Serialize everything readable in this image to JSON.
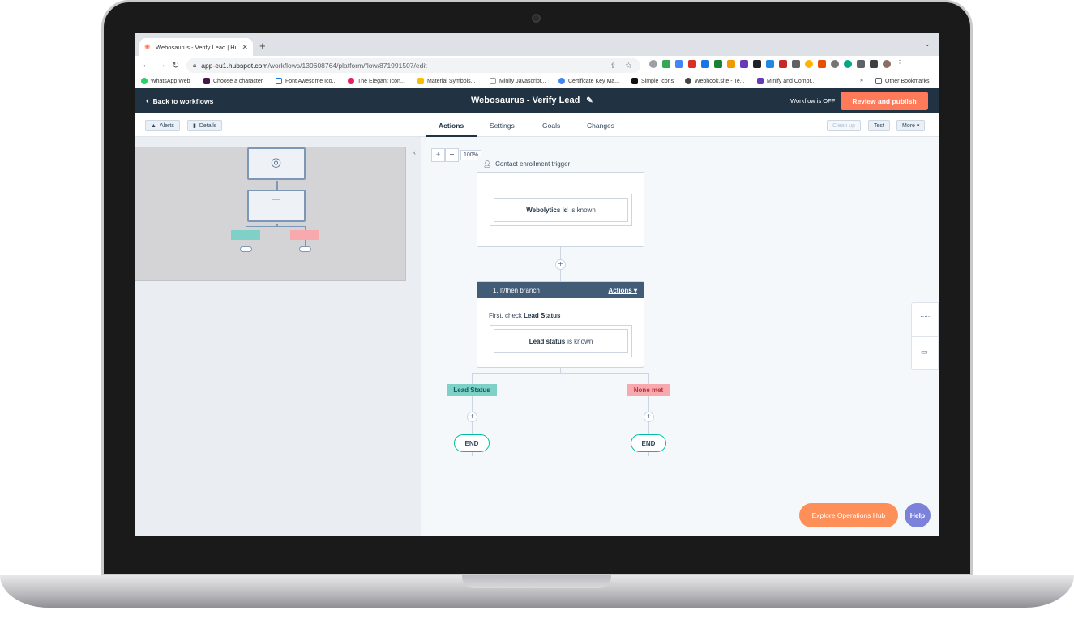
{
  "browser": {
    "tab_title": "Webosaurus - Verify Lead | Hu...",
    "new_tab": "+",
    "url_host": "app-eu1.hubspot.com",
    "url_path": "/workflows/139608764/platform/flow/871991507/edit",
    "bookmarks": [
      "WhatsApp Web",
      "Choose a character",
      "Font Awesome Ico...",
      "The Elegant Icon...",
      "Material Symbols...",
      "Minify Javascript...",
      "Certificate Key Ma...",
      "Simple Icons",
      "Webhook.site - Te...",
      "Minify and Compr..."
    ],
    "bookmarks_more": "»",
    "other_bookmarks": "Other Bookmarks"
  },
  "header": {
    "back_label": "Back to workflows",
    "workflow_name": "Webosaurus - Verify Lead",
    "status_text": "Workflow is OFF",
    "publish_label": "Review and publish"
  },
  "toolbar": {
    "alerts_label": "Alerts",
    "details_label": "Details",
    "tabs": [
      "Actions",
      "Settings",
      "Goals",
      "Changes"
    ],
    "cleanup_label": "Clean up",
    "test_label": "Test",
    "more_label": "More ▾"
  },
  "canvas": {
    "zoom_level": "100%",
    "zoom_in": "+",
    "zoom_out": "−",
    "trigger": {
      "title": "Contact enrollment trigger",
      "property": "Webolytics Id",
      "operator": "is known"
    },
    "branch": {
      "title": "1. If/then branch",
      "actions_label": "Actions ▾",
      "check_prefix": "First, check",
      "check_property": "Lead Status",
      "condition_property": "Lead status",
      "condition_operator": "is known",
      "left_tag": "Lead Status",
      "right_tag": "None met"
    },
    "end_label": "END",
    "plus": "+"
  },
  "footer": {
    "explore_label": "Explore Operations Hub",
    "help_label": "Help"
  },
  "colors": {
    "header_bg": "#213343",
    "accent": "#ff7a59",
    "branch_green": "#7fd1c7",
    "branch_red": "#f8a9ad"
  }
}
